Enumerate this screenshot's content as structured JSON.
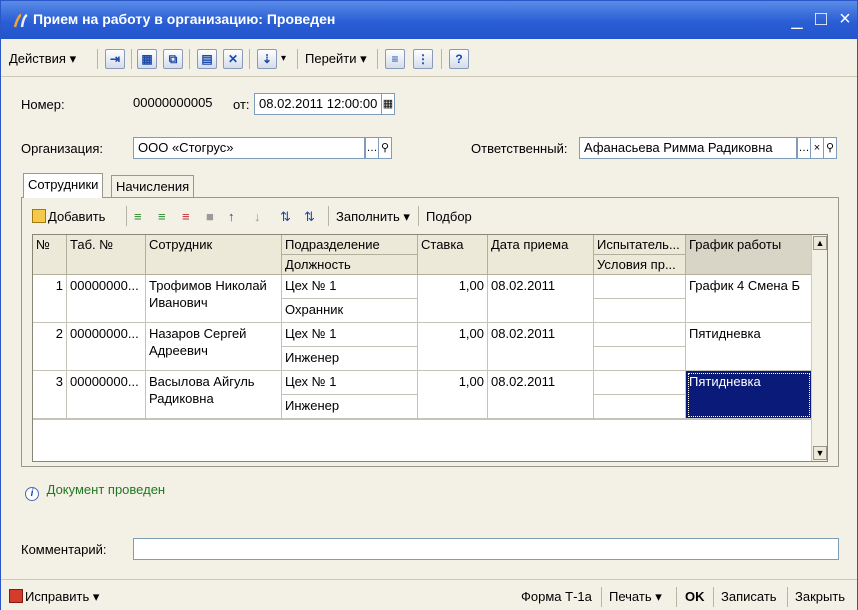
{
  "window": {
    "title": "Прием на работу в организацию: Проведен",
    "controls": [
      "_",
      "□",
      "×"
    ]
  },
  "toolbar": {
    "actions_label": "Действия ▾",
    "goto_label": "Перейти ▾",
    "help_label": "?"
  },
  "form": {
    "number_label": "Номер:",
    "number_value": "00000000005",
    "date_label": "от:",
    "date_value": "08.02.2011 12:00:00",
    "org_label": "Организация:",
    "org_value": "ООО «Стогрус»",
    "resp_label": "Ответственный:",
    "resp_value": "Афанасьева Римма Радиковна",
    "comment_label": "Комментарий:",
    "comment_value": ""
  },
  "tabs": [
    "Сотрудники",
    "Начисления"
  ],
  "grid_toolbar": {
    "add_label": "Добавить",
    "fill_label": "Заполнить ▾",
    "select_label": "Подбор"
  },
  "grid": {
    "headers": {
      "num": "№",
      "tab": "Таб. №",
      "employee": "Сотрудник",
      "dept": "Подразделение",
      "position": "Должность",
      "rate": "Ставка",
      "hire_date": "Дата приема",
      "trial": "Испытатель...",
      "conditions": "Условия пр...",
      "schedule": "График работы"
    },
    "rows": [
      {
        "num": "1",
        "tab": "00000000...",
        "employee": "Трофимов Николай Иванович",
        "dept": "Цех № 1",
        "position": "Охранник",
        "rate": "1,00",
        "hire_date": "08.02.2011",
        "trial": "",
        "conditions": "",
        "schedule": "График 4 Смена Б"
      },
      {
        "num": "2",
        "tab": "00000000...",
        "employee": "Назаров Сергей Адреевич",
        "dept": "Цех № 1",
        "position": "Инженер",
        "rate": "1,00",
        "hire_date": "08.02.2011",
        "trial": "",
        "conditions": "",
        "schedule": "Пятидневка"
      },
      {
        "num": "3",
        "tab": "00000000...",
        "employee": "Васылова Айгуль Радиковна",
        "dept": "Цех № 1",
        "position": "Инженер",
        "rate": "1,00",
        "hire_date": "08.02.2011",
        "trial": "",
        "conditions": "",
        "schedule": "Пятидневка"
      }
    ]
  },
  "info": {
    "icon": "info-icon",
    "text": "Документ проведен"
  },
  "status": {
    "fix_label": "Исправить ▾",
    "form_label": "Форма Т-1а",
    "print_label": "Печать ▾",
    "ok_label": "OK",
    "save_label": "Записать",
    "close_label": "Закрыть"
  },
  "colors": {
    "title_bar": "#2a5ed4",
    "selected_cell": "#0a1a78",
    "info_text": "#1f7a1f"
  }
}
